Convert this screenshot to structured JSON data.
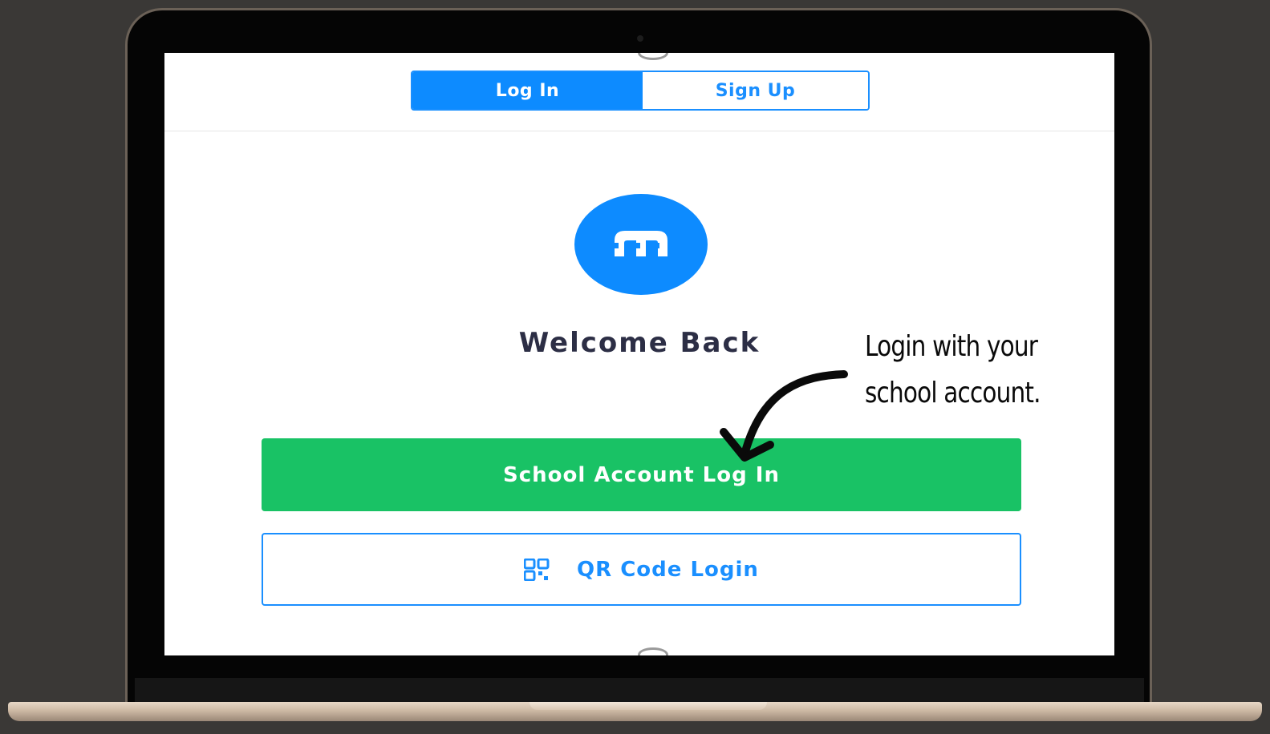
{
  "tabs": [
    {
      "label": "Log In",
      "active": true
    },
    {
      "label": "Sign Up",
      "active": false
    }
  ],
  "logo": {
    "icon": "m-logo-icon",
    "color": "#0d8bff"
  },
  "heading": "Welcome Back",
  "buttons": {
    "school_login": {
      "label": "School Account Log In",
      "color": "#19c265"
    },
    "qr_login": {
      "label": "QR Code Login",
      "icon": "qr-code-icon",
      "color": "#1a8fff"
    }
  },
  "annotation": {
    "line1": "Login with your",
    "line2": "school account."
  },
  "colors": {
    "primary": "#0d8bff",
    "success": "#19c265",
    "heading": "#2c2e45"
  }
}
